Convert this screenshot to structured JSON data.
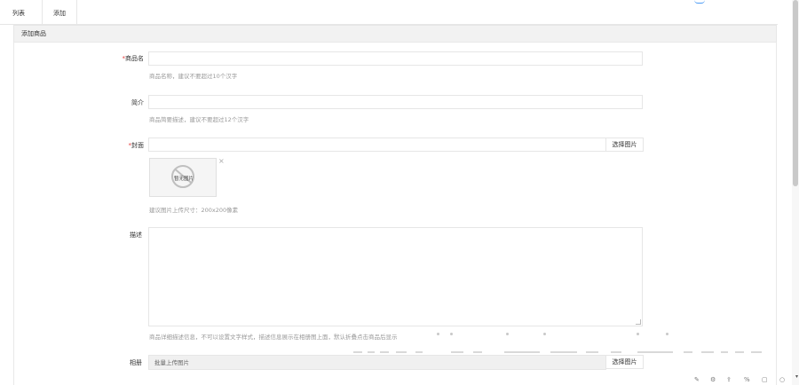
{
  "tabs": [
    {
      "label": "列表"
    },
    {
      "label": "添加"
    }
  ],
  "card": {
    "title": "添加商品"
  },
  "form": {
    "name": {
      "label": "商品名",
      "required": true,
      "hint": "商品名称，建议不要超过10个汉字"
    },
    "intro": {
      "label": "简介",
      "hint": "商品简要描述，建议不要超过12个汉字"
    },
    "cover": {
      "label": "封面",
      "required": true,
      "button": "选择图片",
      "placeholder_text": "暂无图片",
      "hint": "建议图片上传尺寸：200x200像素"
    },
    "desc": {
      "label": "描述",
      "hint": "商品详细描述信息，不可以设置文字样式，描述信息展示在相册图上面，默认折叠点击商品后显示"
    },
    "gallery": {
      "label": "相册",
      "placeholder": "批量上传图片",
      "button": "选择图片"
    }
  },
  "icons": {
    "close": "close-icon",
    "no_image": "no-image-icon",
    "scroll_down": "chevron-down-icon"
  },
  "colors": {
    "required": "#e63a3a",
    "accent": "#4d9cf5"
  }
}
